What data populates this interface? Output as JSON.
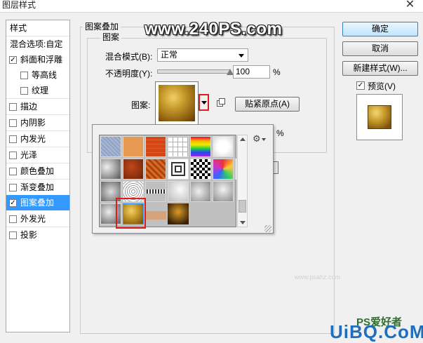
{
  "window": {
    "title": "图层样式",
    "close": "✕"
  },
  "sidebar": {
    "header": "样式",
    "items": [
      {
        "label": "混合选项:自定",
        "checkbox": false,
        "checked": false,
        "selected": false
      },
      {
        "label": "斜面和浮雕",
        "checkbox": true,
        "checked": true,
        "selected": false
      },
      {
        "label": "等高线",
        "checkbox": true,
        "checked": false,
        "selected": false
      },
      {
        "label": "纹理",
        "checkbox": true,
        "checked": false,
        "selected": false
      },
      {
        "label": "描边",
        "checkbox": true,
        "checked": false,
        "selected": false
      },
      {
        "label": "内阴影",
        "checkbox": true,
        "checked": false,
        "selected": false
      },
      {
        "label": "内发光",
        "checkbox": true,
        "checked": false,
        "selected": false
      },
      {
        "label": "光泽",
        "checkbox": true,
        "checked": false,
        "selected": false
      },
      {
        "label": "颜色叠加",
        "checkbox": true,
        "checked": false,
        "selected": false
      },
      {
        "label": "渐变叠加",
        "checkbox": true,
        "checked": false,
        "selected": false
      },
      {
        "label": "图案叠加",
        "checkbox": true,
        "checked": true,
        "selected": true
      },
      {
        "label": "外发光",
        "checkbox": true,
        "checked": false,
        "selected": false
      },
      {
        "label": "投影",
        "checkbox": true,
        "checked": false,
        "selected": false
      }
    ]
  },
  "panel": {
    "group_title": "图案叠加",
    "subgroup_title": "图案",
    "blend_mode_label": "混合模式(B):",
    "blend_mode_value": "正常",
    "opacity_label": "不透明度(Y):",
    "opacity_value": "100",
    "opacity_unit": "%",
    "opacity_level": 1.0,
    "pattern_label": "图案:",
    "snap_origin_button": "贴紧原点(A)",
    "hidden_percent": "%"
  },
  "buttons": {
    "ok": "确定",
    "cancel": "取消",
    "new_style": "新建样式(W)...",
    "preview_label": "预览(V)",
    "preview_checked": true
  },
  "popup": {
    "gear": "⚙",
    "swatches": [
      [
        "blue-fabric",
        "orange-paper",
        "orange-tile",
        "white-grid",
        "rainbow",
        "white-noise"
      ],
      [
        "gray-rock",
        "rust",
        "orange-pattern",
        "concentric-squares",
        "checker",
        "colorful",
        "gray-cloud"
      ],
      [
        "gray-stone",
        "gray-crinkle",
        "zigzag",
        "white-texture",
        "gray-cloud-2",
        "gray-cloud-3"
      ],
      [
        "gray-crumple",
        "gold-texture",
        "tan",
        "dark-gold"
      ]
    ],
    "selected_swatch": "gold-texture"
  },
  "watermarks": {
    "top": "www.240PS.com",
    "bottom_logo": "UiBQ.CoM",
    "bottom_small": "PS爱好者",
    "center_faint": "www.psahz.com"
  },
  "colors": {
    "selection_blue": "#3399ff",
    "highlight_red": "#e21b1b",
    "gold": "#b88a1c"
  }
}
